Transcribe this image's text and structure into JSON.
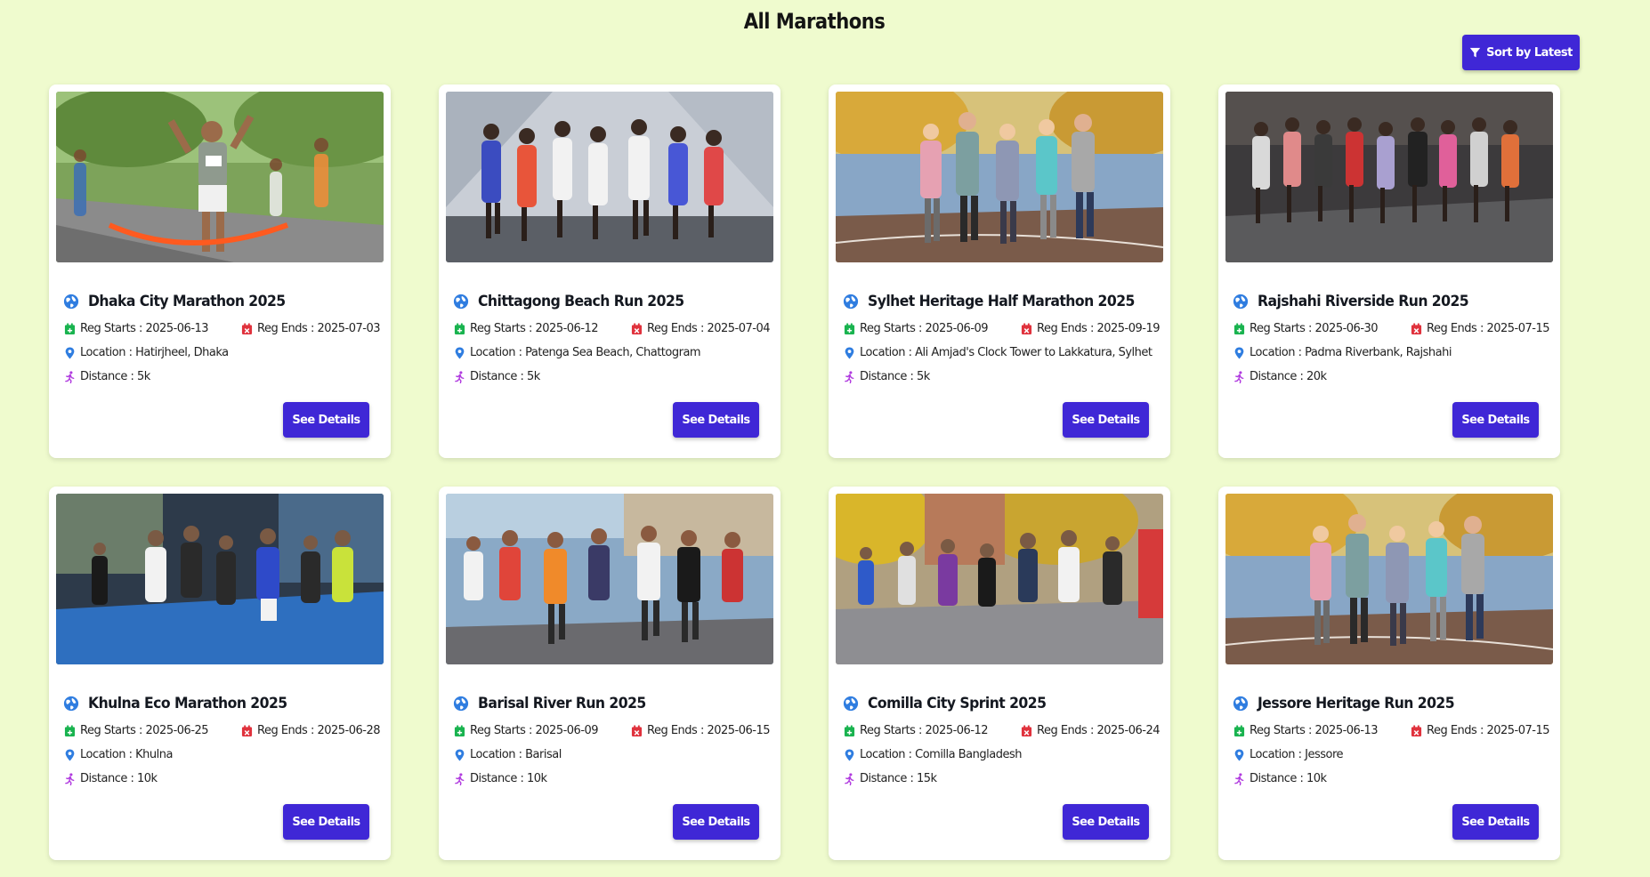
{
  "page": {
    "title": "All Marathons",
    "sort_label": "Sort by Latest"
  },
  "colors": {
    "background": "#effbce",
    "accent": "#3f27d6",
    "reg_start_icon": "#19b34f",
    "reg_end_icon": "#e0323d",
    "location_icon": "#2f7de0",
    "distance_icon": "#b03adf",
    "globe_icon": "#2f7de0"
  },
  "icons": {
    "sort": "filter-icon",
    "title": "globe-icon",
    "reg_start": "calendar-plus-icon",
    "reg_end": "calendar-x-icon",
    "location": "map-pin-icon",
    "distance": "runner-icon"
  },
  "cards": [
    {
      "title": "Dhaka City Marathon 2025",
      "reg_starts": "Reg Starts : 2025-06-13",
      "reg_ends": "Reg Ends : 2025-07-03",
      "location": "Location : Hatirjheel, Dhaka",
      "distance": "Distance : 5k",
      "button": "See Details"
    },
    {
      "title": "Chittagong Beach Run 2025",
      "reg_starts": "Reg Starts : 2025-06-12",
      "reg_ends": "Reg Ends : 2025-07-04",
      "location": "Location : Patenga Sea Beach, Chattogram",
      "distance": "Distance : 5k",
      "button": "See Details"
    },
    {
      "title": "Sylhet Heritage Half Marathon 2025",
      "reg_starts": "Reg Starts : 2025-06-09",
      "reg_ends": "Reg Ends : 2025-09-19",
      "location": "Location : Ali Amjad's Clock Tower to Lakkatura, Sylhet",
      "distance": "Distance : 5k",
      "button": "See Details"
    },
    {
      "title": "Rajshahi Riverside Run 2025",
      "reg_starts": "Reg Starts : 2025-06-30",
      "reg_ends": "Reg Ends : 2025-07-15",
      "location": "Location : Padma Riverbank, Rajshahi",
      "distance": "Distance : 20k",
      "button": "See Details"
    },
    {
      "title": "Khulna Eco Marathon 2025",
      "reg_starts": "Reg Starts : 2025-06-25",
      "reg_ends": "Reg Ends : 2025-06-28",
      "location": "Location : Khulna",
      "distance": "Distance : 10k",
      "button": "See Details"
    },
    {
      "title": "Barisal River Run 2025",
      "reg_starts": "Reg Starts : 2025-06-09",
      "reg_ends": "Reg Ends : 2025-06-15",
      "location": "Location : Barisal",
      "distance": "Distance : 10k",
      "button": "See Details"
    },
    {
      "title": "Comilla City Sprint 2025",
      "reg_starts": "Reg Starts : 2025-06-12",
      "reg_ends": "Reg Ends : 2025-06-24",
      "location": "Location : Comilla Bangladesh",
      "distance": "Distance : 15k",
      "button": "See Details"
    },
    {
      "title": "Jessore Heritage Run 2025",
      "reg_starts": "Reg Starts : 2025-06-13",
      "reg_ends": "Reg Ends : 2025-07-15",
      "location": "Location : Jessore",
      "distance": "Distance : 10k",
      "button": "See Details"
    }
  ]
}
